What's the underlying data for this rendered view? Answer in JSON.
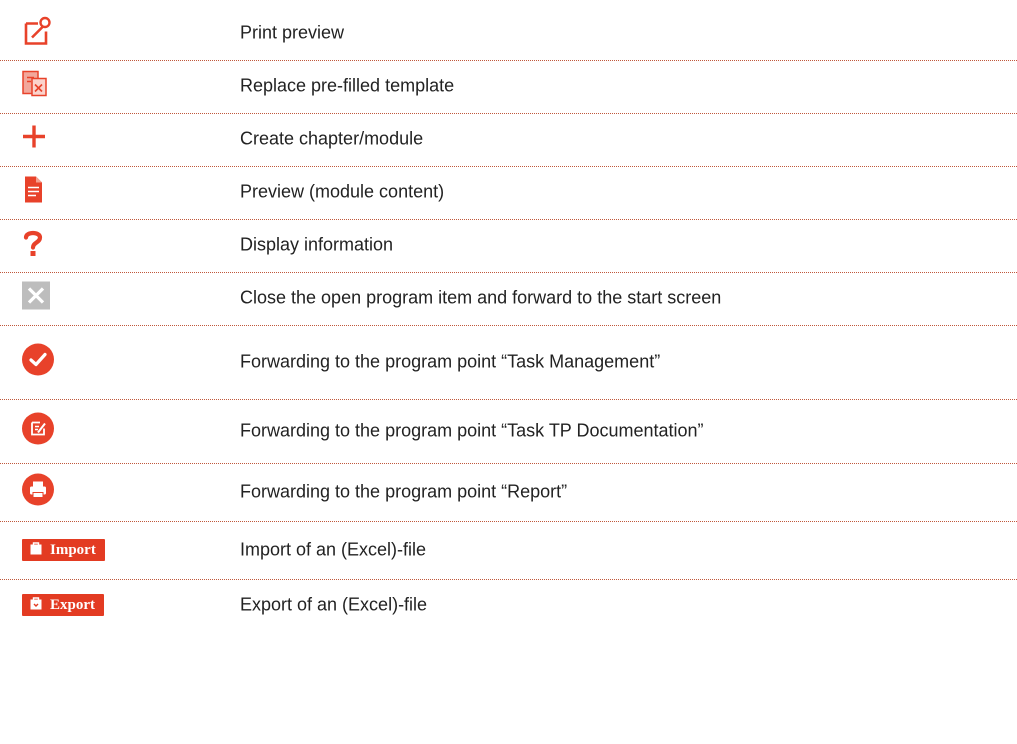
{
  "legend": {
    "rows": [
      {
        "icon": "print-preview-icon",
        "description": "Print preview"
      },
      {
        "icon": "replace-template-icon",
        "description": "Replace pre-filled template"
      },
      {
        "icon": "plus-icon",
        "description": "Create chapter/module"
      },
      {
        "icon": "document-icon",
        "description": "Preview (module content)"
      },
      {
        "icon": "question-mark-icon",
        "description": "Display information"
      },
      {
        "icon": "close-icon",
        "description": "Close the open program item and forward to the start screen"
      },
      {
        "icon": "check-circle-icon",
        "description": "Forwarding to the program point “Task Management”"
      },
      {
        "icon": "edit-circle-icon",
        "description": "Forwarding to the program point “Task TP Documentation”"
      },
      {
        "icon": "printer-circle-icon",
        "description": "Forwarding to the program point “Report”"
      },
      {
        "icon": "import-button",
        "description": "Import of an (Excel)-file"
      },
      {
        "icon": "export-button",
        "description": "Export of an (Excel)-file"
      }
    ]
  },
  "buttons": {
    "import_label": "Import",
    "export_label": "Export"
  },
  "colors": {
    "accent_red": "#e33b22",
    "separator": "#c0583c",
    "close_gray": "#bdbdbd"
  }
}
